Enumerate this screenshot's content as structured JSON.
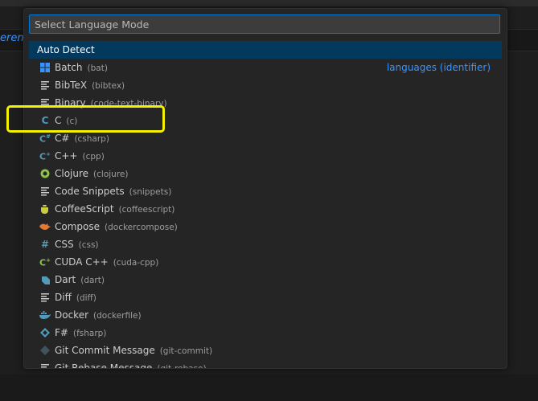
{
  "editor": {
    "fragment": "eren"
  },
  "quick_pick": {
    "placeholder": "Select Language Mode",
    "auto_detect": "Auto Detect",
    "group_label": "languages (identifier)",
    "items": [
      {
        "name": "Batch",
        "id": "(bat)",
        "icon": "windows-icon",
        "icon_color": "#3794ff"
      },
      {
        "name": "BibTeX",
        "id": "(bibtex)",
        "icon": "lines-icon",
        "icon_color": "#cccccc"
      },
      {
        "name": "Binary",
        "id": "(code-text-binary)",
        "icon": "lines-icon",
        "icon_color": "#cccccc"
      },
      {
        "name": "C",
        "id": "(c)",
        "icon": "c-icon",
        "icon_color": "#519aba"
      },
      {
        "name": "C#",
        "id": "(csharp)",
        "icon": "csharp-icon",
        "icon_color": "#519aba"
      },
      {
        "name": "C++",
        "id": "(cpp)",
        "icon": "cpp-icon",
        "icon_color": "#519aba"
      },
      {
        "name": "Clojure",
        "id": "(clojure)",
        "icon": "clojure-icon",
        "icon_color": "#8dc149"
      },
      {
        "name": "Code Snippets",
        "id": "(snippets)",
        "icon": "lines-icon",
        "icon_color": "#cccccc"
      },
      {
        "name": "CoffeeScript",
        "id": "(coffeescript)",
        "icon": "coffee-icon",
        "icon_color": "#cbcb41"
      },
      {
        "name": "Compose",
        "id": "(dockercompose)",
        "icon": "compose-icon",
        "icon_color": "#e37933"
      },
      {
        "name": "CSS",
        "id": "(css)",
        "icon": "hash-icon",
        "icon_color": "#519aba"
      },
      {
        "name": "CUDA C++",
        "id": "(cuda-cpp)",
        "icon": "cuda-icon",
        "icon_color": "#8dc149"
      },
      {
        "name": "Dart",
        "id": "(dart)",
        "icon": "dart-icon",
        "icon_color": "#519aba"
      },
      {
        "name": "Diff",
        "id": "(diff)",
        "icon": "lines-icon",
        "icon_color": "#cccccc"
      },
      {
        "name": "Docker",
        "id": "(dockerfile)",
        "icon": "docker-icon",
        "icon_color": "#519aba"
      },
      {
        "name": "F#",
        "id": "(fsharp)",
        "icon": "fsharp-icon",
        "icon_color": "#519aba"
      },
      {
        "name": "Git Commit Message",
        "id": "(git-commit)",
        "icon": "git-icon",
        "icon_color": "#41535b"
      },
      {
        "name": "Git Rebase Message",
        "id": "(git-rebase)",
        "icon": "lines-icon",
        "icon_color": "#cccccc"
      }
    ]
  },
  "colors": {
    "accent": "#0078d4",
    "selection": "#04395e",
    "highlight_box": "#f5f200",
    "link": "#3794ff"
  }
}
